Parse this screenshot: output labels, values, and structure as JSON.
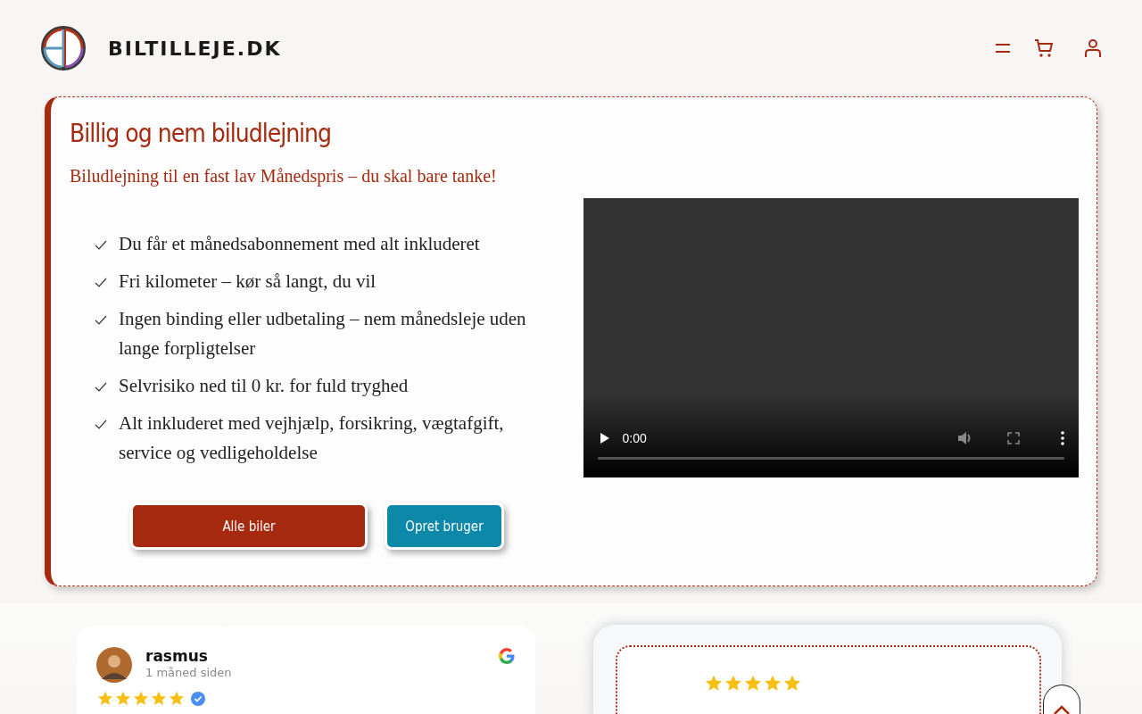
{
  "header": {
    "brand": "BILTILLEJE.DK"
  },
  "hero": {
    "title": "Billig og nem biludlejning",
    "subtitle": "Biludlejning til en fast lav Månedspris – du skal bare tanke!",
    "features": [
      "Du får et månedsabonnement med alt inkluderet",
      "Fri kilometer – kør så langt, du vil",
      "Ingen binding eller udbetaling – nem månedsleje uden lange forpligtelser",
      "Selvrisiko ned til 0 kr. for fuld tryghed",
      "Alt inkluderet med vejhjælp, forsikring, vægtafgift, service og vedligeholdelse"
    ],
    "video": {
      "time": "0:00"
    },
    "buttons": [
      {
        "label": "Alle biler",
        "kind": "primary"
      },
      {
        "label": "Opret bruger",
        "kind": "secondary"
      }
    ]
  },
  "reviews": [
    {
      "name": "rasmus",
      "time": "1 måned siden",
      "stars": 5,
      "verified": true
    }
  ],
  "featured_review": {
    "stars": 5
  }
}
